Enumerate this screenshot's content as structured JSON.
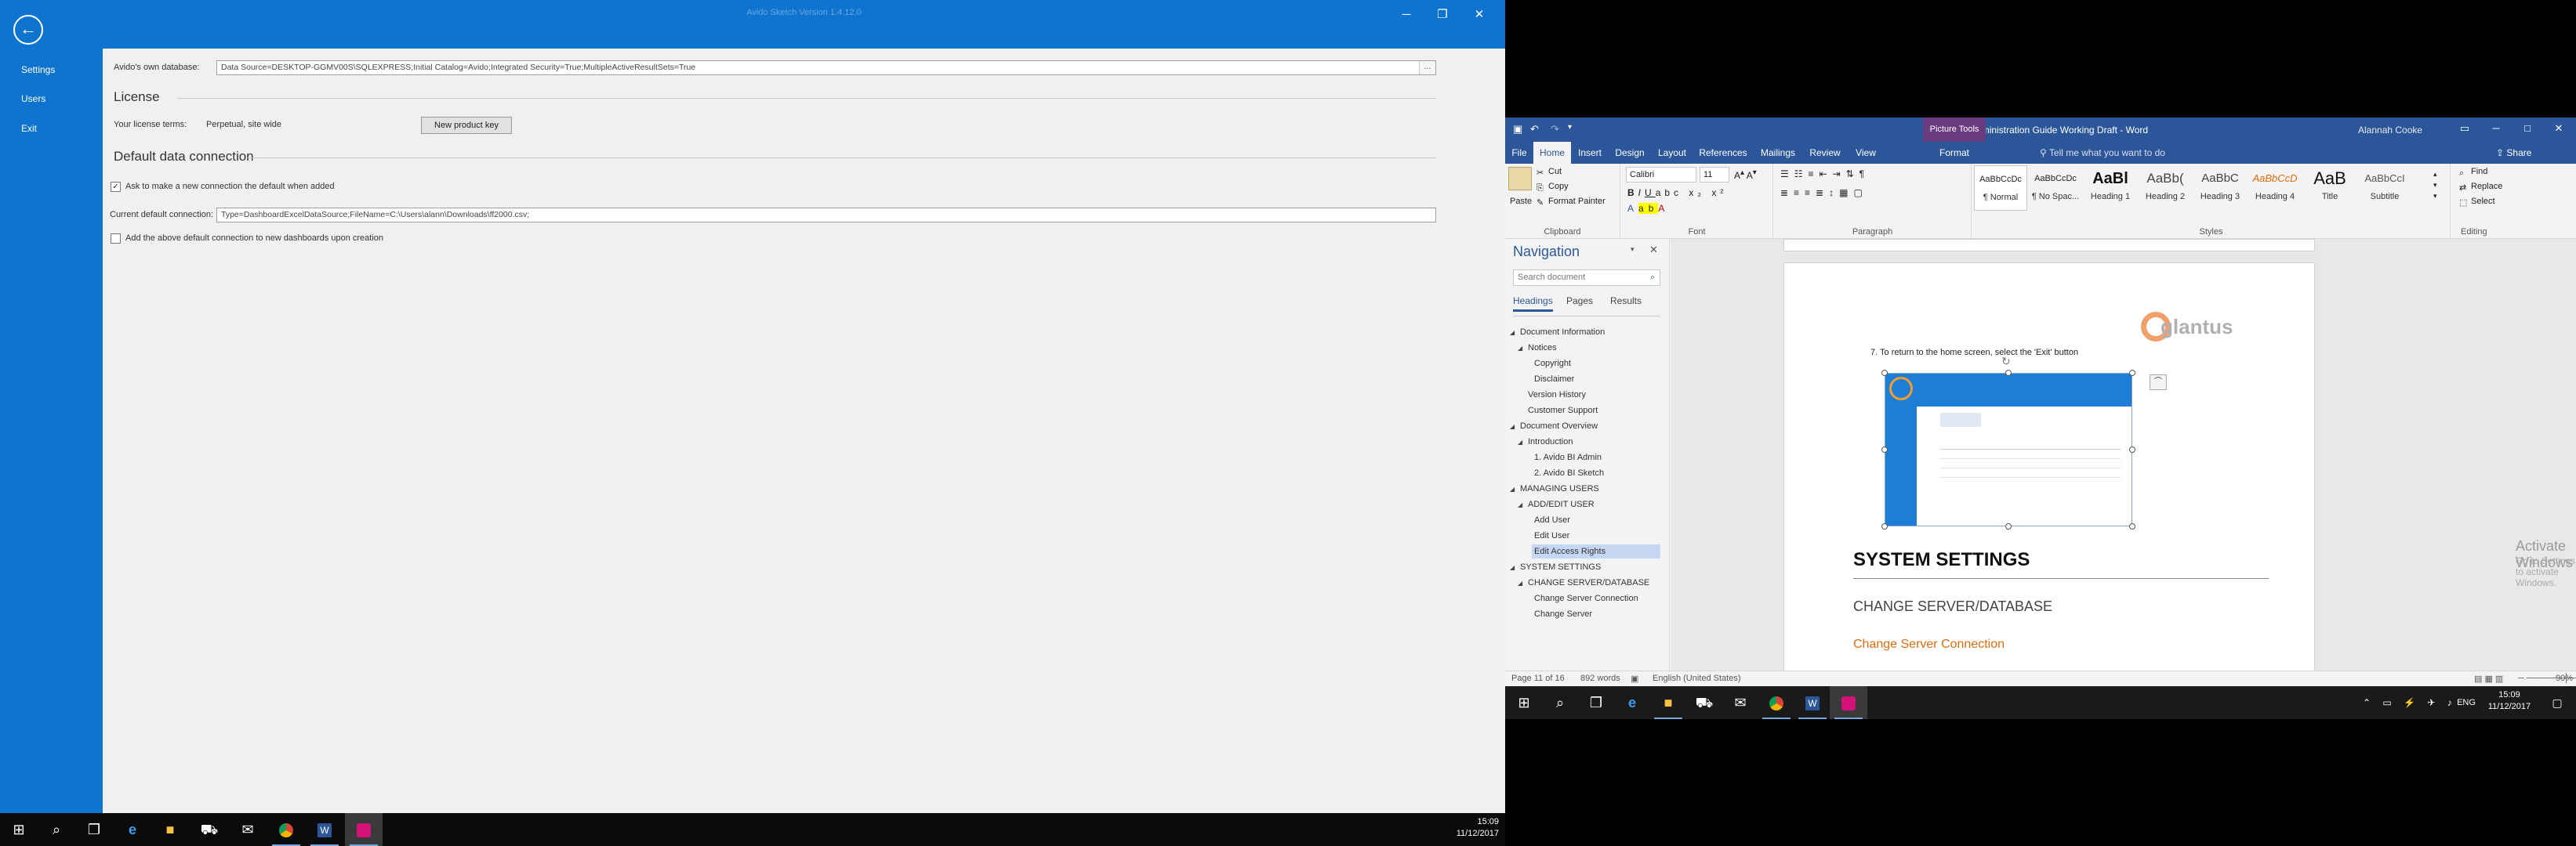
{
  "avido": {
    "window_title": "Avido Sketch  Version 1.4.12.0",
    "sidebar": {
      "items": [
        {
          "label": "Settings"
        },
        {
          "label": "Users"
        },
        {
          "label": "Exit"
        }
      ]
    },
    "db_label": "Avido's own database:",
    "db_value": "Data Source=DESKTOP-GGMV00S\\SQLEXPRESS;Initial Catalog=Avido;Integrated Security=True;MultipleActiveResultSets=True",
    "db_ellipsis": "...",
    "license_heading": "License",
    "license_terms_label": "Your license terms:",
    "license_terms_value": "Perpetual, site wide",
    "new_key_button": "New product key",
    "default_conn_heading": "Default data connection",
    "ask_default_label": "Ask to make a new connection the default when added",
    "ask_default_checked": true,
    "current_conn_label": "Current default connection:",
    "current_conn_value": "Type=DashboardExcelDataSource;FileName=C:\\Users\\alann\\Downloads\\ff2000.csv;",
    "add_default_label": "Add the above default connection to new dashboards upon creation",
    "add_default_checked": false
  },
  "left_taskbar": {
    "time": "15:09",
    "date": "11/12/2017",
    "icons": [
      "windows-icon",
      "search-icon",
      "task-view-icon",
      "edge-icon",
      "file-explorer-icon",
      "store-icon",
      "mail-icon",
      "chrome-icon",
      "word-icon",
      "avido-icon"
    ]
  },
  "word": {
    "doc_title": "Avido BI Administration Guide Working Draft  -  Word",
    "picture_tools": "Picture Tools",
    "user": "Alannah Cooke",
    "tabs": [
      "File",
      "Home",
      "Insert",
      "Design",
      "Layout",
      "References",
      "Mailings",
      "Review",
      "View",
      "Format"
    ],
    "active_tab": "Home",
    "tell_me": "Tell me what you want to do",
    "share": "Share",
    "clipboard": {
      "paste": "Paste",
      "cut": "Cut",
      "copy": "Copy",
      "format_painter": "Format Painter",
      "name": "Clipboard"
    },
    "font": {
      "family": "Calibri",
      "size": "11",
      "name": "Font"
    },
    "paragraph_name": "Paragraph",
    "styles": {
      "name": "Styles",
      "items": [
        {
          "preview": "AaBbCcDc",
          "label": "¶ Normal"
        },
        {
          "preview": "AaBbCcDc",
          "label": "¶ No Spac..."
        },
        {
          "preview": "AaBl",
          "label": "Heading 1"
        },
        {
          "preview": "AaBb(",
          "label": "Heading 2"
        },
        {
          "preview": "AaBbC",
          "label": "Heading 3"
        },
        {
          "preview": "AaBbCcD",
          "label": "Heading 4"
        },
        {
          "preview": "AaB",
          "label": "Title"
        },
        {
          "preview": "AaBbCcI",
          "label": "Subtitle"
        }
      ]
    },
    "editing": {
      "find": "Find",
      "replace": "Replace",
      "select": "Select",
      "name": "Editing"
    },
    "navigation": {
      "title": "Navigation",
      "search_placeholder": "Search document",
      "tabs": [
        "Headings",
        "Pages",
        "Results"
      ],
      "headings": [
        {
          "label": "Document Information",
          "level": 1,
          "expandable": true
        },
        {
          "label": "Notices",
          "level": 2,
          "expandable": true
        },
        {
          "label": "Copyright",
          "level": 3
        },
        {
          "label": "Disclaimer",
          "level": 3
        },
        {
          "label": "Version History",
          "level": 2
        },
        {
          "label": "Customer Support",
          "level": 2
        },
        {
          "label": "Document Overview",
          "level": 1,
          "expandable": true
        },
        {
          "label": "Introduction",
          "level": 2,
          "expandable": true
        },
        {
          "label": "1. Avido BI Admin",
          "level": 3
        },
        {
          "label": "2. Avido BI Sketch",
          "level": 3
        },
        {
          "label": "MANAGING USERS",
          "level": 1,
          "expandable": true
        },
        {
          "label": "ADD/EDIT USER",
          "level": 2,
          "expandable": true
        },
        {
          "label": "Add User",
          "level": 3
        },
        {
          "label": "Edit User",
          "level": 3
        },
        {
          "label": "Edit Access Rights",
          "level": 3,
          "selected": true
        },
        {
          "label": "SYSTEM SETTINGS",
          "level": 1,
          "expandable": true
        },
        {
          "label": "CHANGE SERVER/DATABASE",
          "level": 2,
          "expandable": true
        },
        {
          "label": "Change Server Connection",
          "level": 3
        },
        {
          "label": "Change Server",
          "level": 3
        }
      ]
    },
    "document": {
      "step_text": "7.   To return to the home screen, select the 'Exit' button",
      "logo_text": "glantus",
      "heading1": "SYSTEM SETTINGS",
      "heading2": "CHANGE SERVER/DATABASE",
      "heading3": "Change Server Connection"
    },
    "watermark_title": "Activate Windows",
    "watermark_sub": "Go to Settings to activate Windows.",
    "status": {
      "page": "Page 11 of 16",
      "words": "892 words",
      "language": "English (United States)",
      "zoom": "90%"
    }
  },
  "right_taskbar": {
    "time": "15:09",
    "date": "11/12/2017",
    "lang": "ENG",
    "icons": [
      "windows-icon",
      "search-icon",
      "task-view-icon",
      "edge-icon",
      "file-explorer-icon",
      "store-icon",
      "mail-icon",
      "chrome-icon",
      "word-icon",
      "avido-icon"
    ]
  },
  "colors": {
    "avido_blue": "#0e74d0",
    "word_blue": "#2b579a",
    "picture_tools": "#6b3b81",
    "heading3_orange": "#e36c0a"
  }
}
